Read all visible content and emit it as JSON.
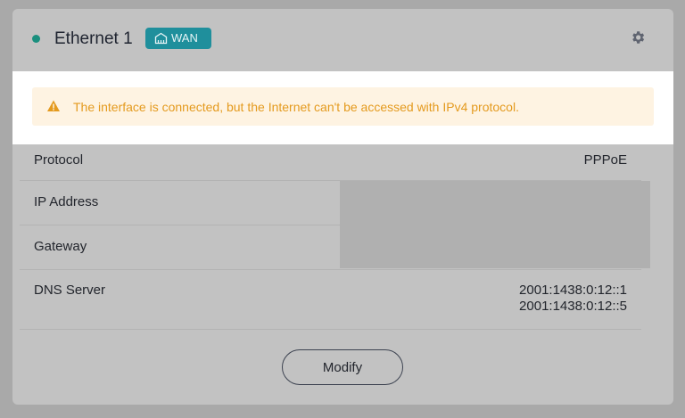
{
  "header": {
    "title": "Ethernet 1",
    "badge_label": "WAN",
    "status_color": "#1a8f7e",
    "badge_icon": "network-icon",
    "settings_icon": "gear-icon"
  },
  "alert": {
    "icon": "warning-icon",
    "message": "The interface is connected, but the Internet can't be accessed with IPv4 protocol."
  },
  "details": {
    "protocol": {
      "label": "Protocol",
      "value": "PPPoE"
    },
    "ip_address": {
      "label": "IP Address",
      "value": ""
    },
    "gateway": {
      "label": "Gateway",
      "value": ""
    },
    "dns_server": {
      "label": "DNS Server",
      "values": [
        "2001:1438:0:12::1",
        "2001:1438:0:12::5"
      ]
    }
  },
  "actions": {
    "modify_label": "Modify"
  },
  "colors": {
    "accent": "#1f8f9c",
    "warning": "#e49a1e",
    "warning_bg": "#fef3e2"
  }
}
